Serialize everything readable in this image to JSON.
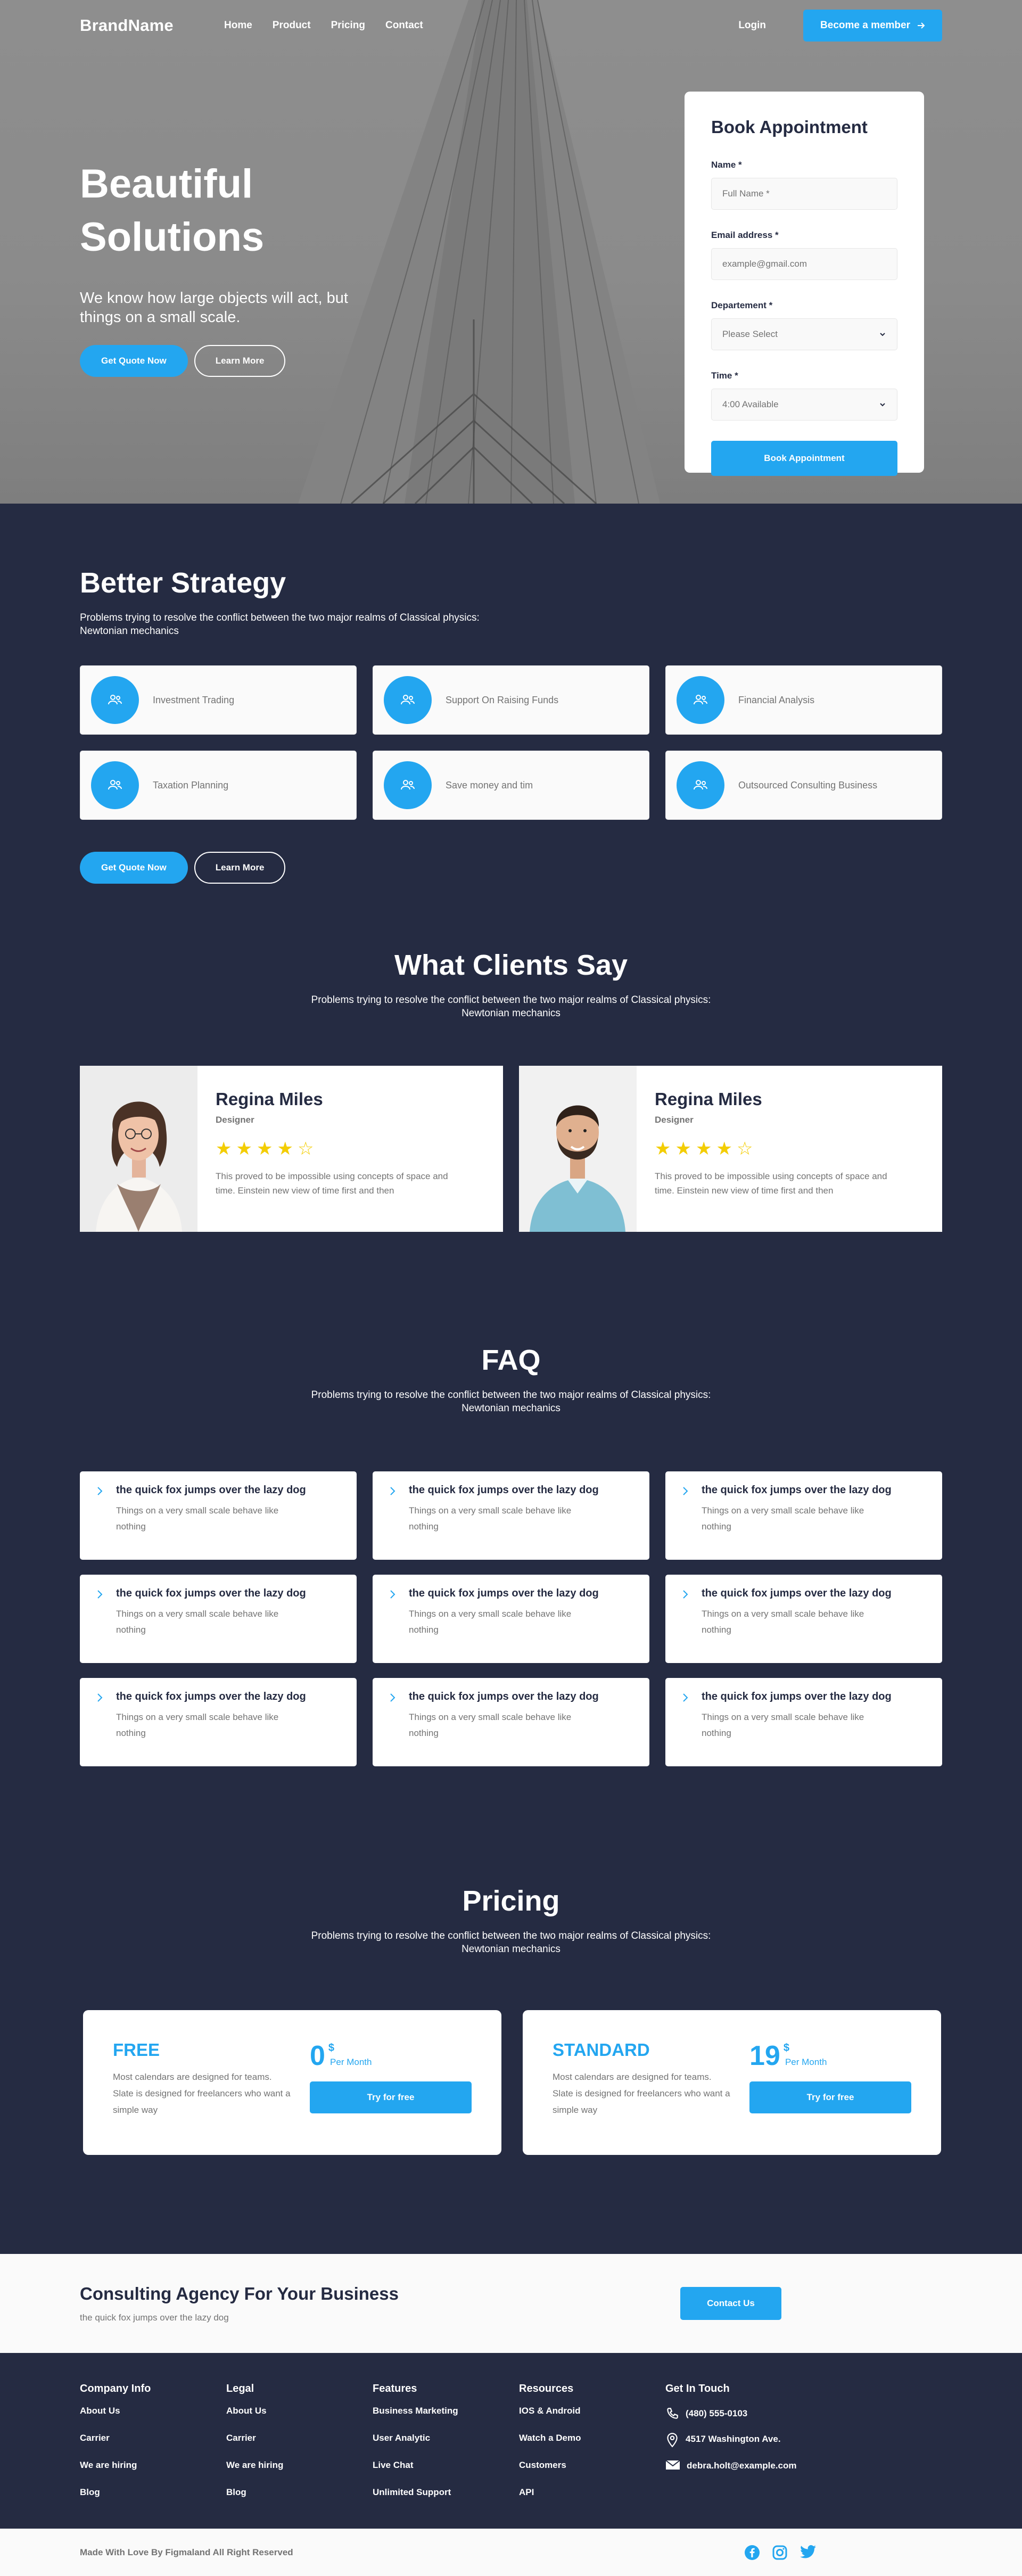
{
  "nav": {
    "brand": "BrandName",
    "links": [
      "Home",
      "Product",
      "Pricing",
      "Contact"
    ],
    "login": "Login",
    "cta": "Become a member"
  },
  "hero": {
    "title_line1": "Beautiful",
    "title_line2": "Solutions",
    "subtitle": "We know how large objects will act, but things on a small scale.",
    "primary_btn": "Get Quote Now",
    "secondary_btn": "Learn More"
  },
  "appointment": {
    "title": "Book Appointment",
    "name_label": "Name *",
    "name_placeholder": "Full Name *",
    "email_label": "Email address *",
    "email_placeholder": "example@gmail.com",
    "department_label": "Departement *",
    "department_value": "Please Select",
    "time_label": "Time *",
    "time_value": "4:00 Available",
    "submit": "Book Appointment"
  },
  "strategy": {
    "title": "Better Strategy",
    "subtitle": "Problems trying to resolve the conflict between the two major realms of Classical physics: Newtonian mechanics",
    "services": [
      "Investment Trading",
      "Support On Raising Funds",
      "Financial Analysis",
      "Taxation Planning",
      "Save money and tim",
      "Outsourced Consulting Business"
    ],
    "primary_btn": "Get Quote Now",
    "secondary_btn": "Learn More"
  },
  "testimonials": {
    "title": "What Clients Say",
    "subtitle": "Problems trying to resolve the conflict between the two major realms of Classical physics: Newtonian mechanics",
    "items": [
      {
        "name": "Regina Miles",
        "role": "Designer",
        "rating": 4,
        "quote": "This proved to be impossible using concepts of space and time. Einstein new view of time first and then"
      },
      {
        "name": "Regina Miles",
        "role": "Designer",
        "rating": 4,
        "quote": "This proved to be impossible using concepts of space and time. Einstein new view of time first and then"
      }
    ]
  },
  "faq": {
    "title": "FAQ",
    "subtitle": "Problems trying to resolve the conflict between the two major realms of Classical physics: Newtonian mechanics",
    "items": [
      {
        "q": "the quick fox jumps over the lazy dog",
        "a": "Things on a very small scale behave like nothing"
      },
      {
        "q": "the quick fox jumps over the lazy dog",
        "a": "Things on a very small scale behave like nothing"
      },
      {
        "q": "the quick fox jumps over the lazy dog",
        "a": "Things on a very small scale behave like nothing"
      },
      {
        "q": "the quick fox jumps over the lazy dog",
        "a": "Things on a very small scale behave like nothing"
      },
      {
        "q": "the quick fox jumps over the lazy dog",
        "a": "Things on a very small scale behave like nothing"
      },
      {
        "q": "the quick fox jumps over the lazy dog",
        "a": "Things on a very small scale behave like nothing"
      },
      {
        "q": "the quick fox jumps over the lazy dog",
        "a": "Things on a very small scale behave like nothing"
      },
      {
        "q": "the quick fox jumps over the lazy dog",
        "a": "Things on a very small scale behave like nothing"
      },
      {
        "q": "the quick fox jumps over the lazy dog",
        "a": "Things on a very small scale behave like nothing"
      }
    ]
  },
  "pricing": {
    "title": "Pricing",
    "subtitle": "Problems trying to resolve the conflict between the two major realms of Classical physics: Newtonian mechanics",
    "plans": [
      {
        "name": "FREE",
        "desc": "Most calendars are designed for teams. Slate is designed for freelancers who want a simple way",
        "price": "0",
        "currency": "$",
        "period": "Per Month",
        "btn": "Try for free"
      },
      {
        "name": "STANDARD",
        "desc": "Most calendars are designed for teams. Slate is designed for freelancers who want a simple way",
        "price": "19",
        "currency": "$",
        "period": "Per Month",
        "btn": "Try for free"
      }
    ]
  },
  "cta": {
    "title": "Consulting Agency For Your Business",
    "subtitle": "the quick fox jumps over the lazy dog",
    "btn": "Contact Us"
  },
  "footer": {
    "columns": [
      {
        "title": "Company Info",
        "links": [
          "About Us",
          "Carrier",
          "We are hiring",
          "Blog"
        ]
      },
      {
        "title": "Legal",
        "links": [
          "About Us",
          "Carrier",
          "We are hiring",
          "Blog"
        ]
      },
      {
        "title": "Features",
        "links": [
          "Business Marketing",
          "User Analytic",
          "Live Chat",
          "Unlimited Support"
        ]
      },
      {
        "title": "Resources",
        "links": [
          "IOS & Android",
          "Watch a Demo",
          "Customers",
          "API"
        ]
      }
    ],
    "contact_title": "Get In Touch",
    "phone": "(480) 555-0103",
    "address": "4517 Washington Ave.",
    "email": "debra.holt@example.com",
    "copyright": "Made With Love By Figmaland All Right Reserved"
  },
  "colors": {
    "primary": "#23a6f0",
    "dark": "#252b42",
    "muted": "#737373",
    "star": "#f3cd03"
  }
}
